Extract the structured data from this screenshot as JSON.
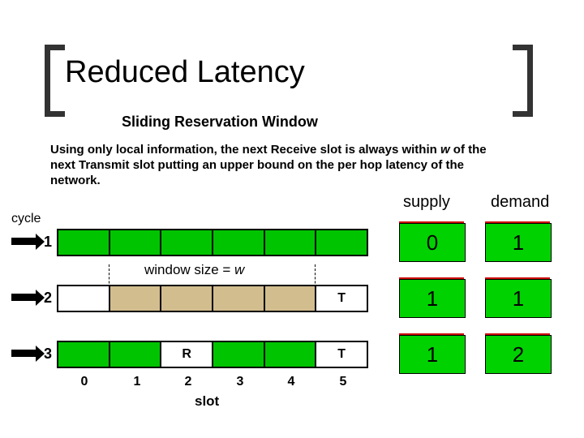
{
  "title": "Reduced Latency",
  "subtitle": "Sliding Reservation Window",
  "paragraph_parts": {
    "p1": "Using only local information, the next Receive slot is always within ",
    "w": "w",
    "p2": " of the next Transmit slot putting an upper bound on the per hop latency of  the network."
  },
  "labels": {
    "cycle": "cycle",
    "supply": "supply",
    "demand": "demand",
    "windowsize_prefix": "window size = ",
    "windowsize_w": "w",
    "slot": "slot"
  },
  "chart_data": {
    "type": "table",
    "slot_axis": [
      "0",
      "1",
      "2",
      "3",
      "4",
      "5"
    ],
    "cycles": [
      {
        "id": "1",
        "highlighted_slots": [],
        "R": null,
        "T": null
      },
      {
        "id": "2",
        "highlighted_slots": [
          1,
          2,
          3,
          4
        ],
        "R": null,
        "T": 5
      },
      {
        "id": "3",
        "highlighted_slots": [],
        "R": 2,
        "T": 5
      }
    ],
    "window_size_w_span_slots": [
      1,
      5
    ],
    "cell_letters": {
      "R": "R",
      "T": "T"
    },
    "supply_demand": [
      {
        "cycle": "1",
        "supply": "0",
        "demand": "1"
      },
      {
        "cycle": "2",
        "supply": "1",
        "demand": "1"
      },
      {
        "cycle": "3",
        "supply": "1",
        "demand": "2"
      }
    ]
  }
}
